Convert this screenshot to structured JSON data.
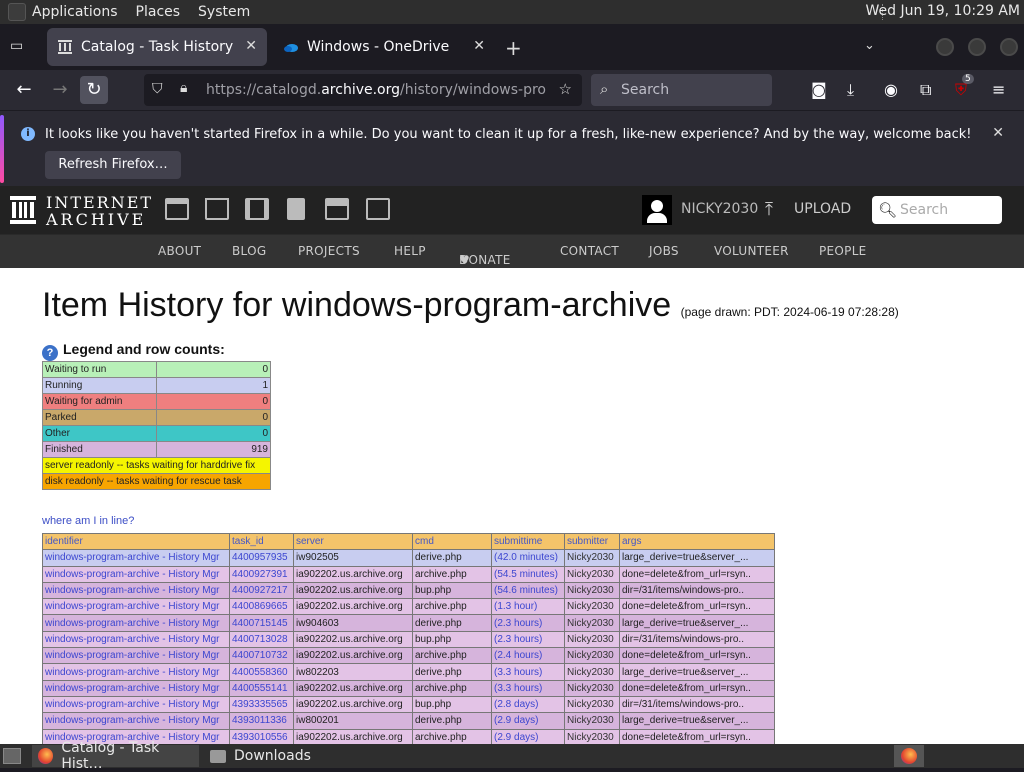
{
  "topbar": {
    "menus": [
      "Applications",
      "Places",
      "System"
    ],
    "clock": "Wed Jun 19, 10:29 AM"
  },
  "tabs": [
    {
      "title": "Catalog - Task History",
      "active": true
    },
    {
      "title": "Windows - OneDrive",
      "active": false
    }
  ],
  "navbar": {
    "url_prefix": "https://catalogd.",
    "url_domain": "archive.org",
    "url_suffix": "/history/windows-program",
    "search_placeholder": "Search",
    "extension_badge": "5"
  },
  "notification": {
    "message": "It looks like you haven't started Firefox in a while. Do you want to clean it up for a fresh, like-new experience? And by the way, welcome back!",
    "button": "Refresh Firefox…"
  },
  "ia": {
    "logo_line1": "INTERNET",
    "logo_line2": "ARCHIVE",
    "username": "NICKY2030",
    "upload": "UPLOAD",
    "search_placeholder": "Search",
    "nav": [
      "ABOUT",
      "BLOG",
      "PROJECTS",
      "HELP",
      "DONATE",
      "CONTACT",
      "JOBS",
      "VOLUNTEER",
      "PEOPLE"
    ]
  },
  "page": {
    "title": "Item History for windows-program-archive",
    "drawn": "(page drawn: PDT: 2024-06-19 07:28:28)",
    "legend_heading": "Legend and row counts:",
    "where_link": "where am I in line?"
  },
  "legend": [
    {
      "label": "Waiting to run",
      "count": "0",
      "color": "#b8f0b8"
    },
    {
      "label": "Running",
      "count": "1",
      "color": "#c8cdf0"
    },
    {
      "label": "Waiting for admin",
      "count": "0",
      "color": "#ef7f7f"
    },
    {
      "label": "Parked",
      "count": "0",
      "color": "#c9a86a"
    },
    {
      "label": "Other",
      "count": "0",
      "color": "#3ec6c6"
    },
    {
      "label": "Finished",
      "count": "919",
      "color": "#d6b4dc"
    }
  ],
  "legend_notes": [
    {
      "text": "server readonly -- tasks waiting for harddrive fix",
      "color": "#f5f500"
    },
    {
      "text": "disk readonly -- tasks waiting for rescue task",
      "color": "#f7a500"
    }
  ],
  "task_headers": [
    "identifier",
    "task_id",
    "server",
    "cmd",
    "submittime",
    "submitter",
    "args"
  ],
  "tasks": [
    {
      "identifier": "windows-program-archive - History Mgr",
      "task_id": "4400957935",
      "server": "iw902505",
      "cmd": "derive.php",
      "time": "(42.0 minutes)",
      "submitter": "Nicky2030",
      "args": "large_derive=true&server_...",
      "state": "running"
    },
    {
      "identifier": "windows-program-archive - History Mgr",
      "task_id": "4400927391",
      "server": "ia902202.us.archive.org",
      "cmd": "archive.php",
      "time": "(54.5 minutes)",
      "submitter": "Nicky2030",
      "args": "done=delete&from_url=rsyn..",
      "state": "finished"
    },
    {
      "identifier": "windows-program-archive - History Mgr",
      "task_id": "4400927217",
      "server": "ia902202.us.archive.org",
      "cmd": "bup.php",
      "time": "(54.6 minutes)",
      "submitter": "Nicky2030",
      "args": "dir=/31/items/windows-pro..",
      "state": "finished"
    },
    {
      "identifier": "windows-program-archive - History Mgr",
      "task_id": "4400869665",
      "server": "ia902202.us.archive.org",
      "cmd": "archive.php",
      "time": "(1.3 hour)",
      "submitter": "Nicky2030",
      "args": "done=delete&from_url=rsyn..",
      "state": "finished"
    },
    {
      "identifier": "windows-program-archive - History Mgr",
      "task_id": "4400715145",
      "server": "iw904603",
      "cmd": "derive.php",
      "time": "(2.3 hours)",
      "submitter": "Nicky2030",
      "args": "large_derive=true&server_...",
      "state": "finished"
    },
    {
      "identifier": "windows-program-archive - History Mgr",
      "task_id": "4400713028",
      "server": "ia902202.us.archive.org",
      "cmd": "bup.php",
      "time": "(2.3 hours)",
      "submitter": "Nicky2030",
      "args": "dir=/31/items/windows-pro..",
      "state": "finished"
    },
    {
      "identifier": "windows-program-archive - History Mgr",
      "task_id": "4400710732",
      "server": "ia902202.us.archive.org",
      "cmd": "archive.php",
      "time": "(2.4 hours)",
      "submitter": "Nicky2030",
      "args": "done=delete&from_url=rsyn..",
      "state": "finished"
    },
    {
      "identifier": "windows-program-archive - History Mgr",
      "task_id": "4400558360",
      "server": "iw802203",
      "cmd": "derive.php",
      "time": "(3.3 hours)",
      "submitter": "Nicky2030",
      "args": "large_derive=true&server_...",
      "state": "finished"
    },
    {
      "identifier": "windows-program-archive - History Mgr",
      "task_id": "4400555141",
      "server": "ia902202.us.archive.org",
      "cmd": "archive.php",
      "time": "(3.3 hours)",
      "submitter": "Nicky2030",
      "args": "done=delete&from_url=rsyn..",
      "state": "finished"
    },
    {
      "identifier": "windows-program-archive - History Mgr",
      "task_id": "4393335565",
      "server": "ia902202.us.archive.org",
      "cmd": "bup.php",
      "time": "(2.8 days)",
      "submitter": "Nicky2030",
      "args": "dir=/31/items/windows-pro..",
      "state": "finished"
    },
    {
      "identifier": "windows-program-archive - History Mgr",
      "task_id": "4393011336",
      "server": "iw800201",
      "cmd": "derive.php",
      "time": "(2.9 days)",
      "submitter": "Nicky2030",
      "args": "large_derive=true&server_...",
      "state": "finished"
    },
    {
      "identifier": "windows-program-archive - History Mgr",
      "task_id": "4393010556",
      "server": "ia902202.us.archive.org",
      "cmd": "archive.php",
      "time": "(2.9 days)",
      "submitter": "Nicky2030",
      "args": "done=delete&from_url=rsyn..",
      "state": "finished"
    }
  ],
  "taskbar": {
    "items": [
      "Catalog - Task Hist…",
      "Downloads"
    ]
  },
  "colors": {
    "running_row": "#c8cdf0",
    "finished_row": "#d6b4dc",
    "finished_row_alt": "#e3c3e6",
    "header_row": "#f4c46a"
  }
}
